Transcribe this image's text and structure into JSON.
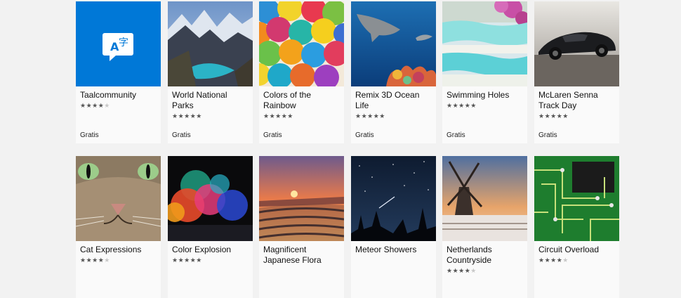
{
  "colors": {
    "background": "#f2f2f2",
    "tile": "#fafafa",
    "accent": "#0078d7"
  },
  "tiles": [
    {
      "title": "Taalcommunity",
      "rating": 4,
      "price": "Gratis",
      "icon": "translate-icon"
    },
    {
      "title": "World National Parks",
      "rating": 5,
      "price": "Gratis"
    },
    {
      "title": "Colors of the Rainbow",
      "rating": 5,
      "price": "Gratis"
    },
    {
      "title": "Remix 3D Ocean Life",
      "rating": 5,
      "price": "Gratis"
    },
    {
      "title": "Swimming Holes",
      "rating": 5,
      "price": "Gratis"
    },
    {
      "title": "McLaren Senna Track Day",
      "rating": 5,
      "price": "Gratis"
    },
    {
      "title": "Cat Expressions",
      "rating": 4,
      "price": ""
    },
    {
      "title": "Color Explosion",
      "rating": 5,
      "price": ""
    },
    {
      "title": "Magnificent Japanese Flora",
      "rating": null,
      "price": ""
    },
    {
      "title": "Meteor Showers",
      "rating": null,
      "price": ""
    },
    {
      "title": "Netherlands Countryside",
      "rating": 4,
      "price": ""
    },
    {
      "title": "Circuit Overload",
      "rating": 4,
      "price": ""
    }
  ]
}
